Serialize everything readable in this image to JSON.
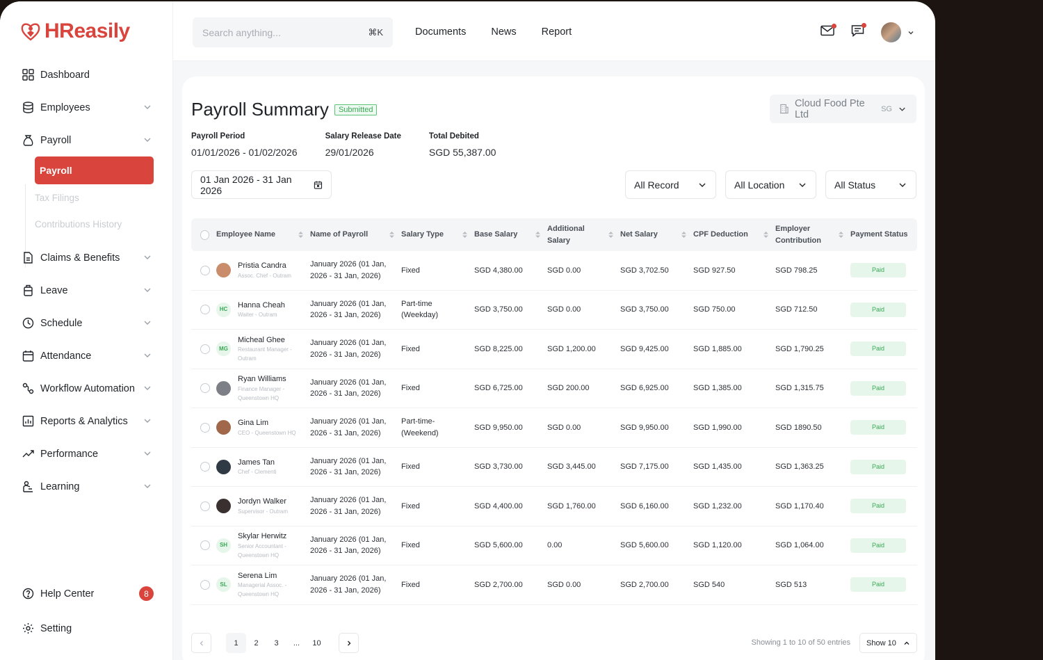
{
  "app": {
    "logo": "HReasily",
    "brand_color": "#d9443c"
  },
  "sidebar": {
    "items": [
      {
        "label": "Dashboard",
        "icon": "grid-icon",
        "chevron": false
      },
      {
        "label": "Employees",
        "icon": "database-icon",
        "chevron": true
      },
      {
        "label": "Payroll",
        "icon": "money-bag-icon",
        "chevron": true
      }
    ],
    "payroll_sub": {
      "active": "Payroll",
      "items": [
        "Tax Filings",
        "Contributions History"
      ]
    },
    "items2": [
      {
        "label": "Claims & Benefits",
        "icon": "document-icon"
      },
      {
        "label": "Leave",
        "icon": "luggage-icon"
      },
      {
        "label": "Schedule",
        "icon": "clock-icon"
      },
      {
        "label": "Attendance",
        "icon": "calendar-icon"
      },
      {
        "label": "Workflow Automation",
        "icon": "workflow-icon"
      },
      {
        "label": "Reports & Analytics",
        "icon": "report-icon"
      },
      {
        "label": "Performance",
        "icon": "trend-icon"
      },
      {
        "label": "Learning",
        "icon": "learning-icon"
      }
    ],
    "help": {
      "label": "Help Center",
      "badge": "8"
    },
    "setting": {
      "label": "Setting"
    }
  },
  "topbar": {
    "search_placeholder": "Search anything...",
    "shortcut": "⌘K",
    "nav": [
      "Documents",
      "News",
      "Report"
    ]
  },
  "page": {
    "title": "Payroll Summary",
    "status": "Submitted",
    "company": "Cloud Food Pte Ltd",
    "company_country": "SG",
    "meta": [
      {
        "label": "Payroll Period",
        "value": "01/01/2026 - 01/02/2026"
      },
      {
        "label": "Salary Release Date",
        "value": "29/01/2026"
      },
      {
        "label": "Total Debited",
        "value": "SGD 55,387.00"
      }
    ],
    "date_range": "01 Jan 2026 - 31 Jan 2026",
    "filters": [
      "All Record",
      "All Location",
      "All Status"
    ]
  },
  "table": {
    "headers": [
      "Employee Name",
      "Name of Payroll",
      "Salary Type",
      "Base Salary",
      "Additional Salary",
      "Net Salary",
      "CPF Deduction",
      "Employer Contribution",
      "Payment Status"
    ],
    "rows": [
      {
        "name": "Pristia Candra",
        "role": "Assoc. Chef - Outram",
        "initials": "",
        "avatar": "#c98d6b",
        "payroll": "January 2026 (01 Jan, 2026 - 31 Jan, 2026)",
        "type": "Fixed",
        "base": "SGD 4,380.00",
        "add": "SGD 0.00",
        "net": "SGD 3,702.50",
        "cpf": "SGD 927.50",
        "emp": "SGD 798.25",
        "status": "Paid"
      },
      {
        "name": "Hanna Cheah",
        "role": "Waiter - Outram",
        "initials": "HC",
        "avatar": "",
        "payroll": "January 2026 (01 Jan, 2026 - 31 Jan, 2026)",
        "type": "Part-time (Weekday)",
        "base": "SGD 3,750.00",
        "add": "SGD 0.00",
        "net": "SGD 3,750.00",
        "cpf": "SGD 750.00",
        "emp": "SGD 712.50",
        "status": "Paid"
      },
      {
        "name": "Micheal Ghee",
        "role": "Restaurant Manager - Outram",
        "initials": "MG",
        "avatar": "",
        "payroll": "January 2026 (01 Jan, 2026 - 31 Jan, 2026)",
        "type": "Fixed",
        "base": "SGD 8,225.00",
        "add": "SGD 1,200.00",
        "net": "SGD 9,425.00",
        "cpf": "SGD 1,885.00",
        "emp": "SGD 1,790.25",
        "status": "Paid"
      },
      {
        "name": "Ryan Williams",
        "role": "Finance Manager - Queenstown HQ",
        "initials": "",
        "avatar": "#7d7f86",
        "payroll": "January 2026 (01 Jan, 2026 - 31 Jan, 2026)",
        "type": "Fixed",
        "base": "SGD 6,725.00",
        "add": "SGD 200.00",
        "net": "SGD 6,925.00",
        "cpf": "SGD 1,385.00",
        "emp": "SGD 1,315.75",
        "status": "Paid"
      },
      {
        "name": "Gina Lim",
        "role": "CEO - Queenstown HQ",
        "initials": "",
        "avatar": "#a0674a",
        "payroll": "January 2026 (01 Jan, 2026 - 31 Jan, 2026)",
        "type": "Part-time- (Weekend)",
        "base": "SGD 9,950.00",
        "add": "SGD 0.00",
        "net": "SGD 9,950.00",
        "cpf": "SGD 1,990.00",
        "emp": "SGD 1890.50",
        "status": "Paid"
      },
      {
        "name": "James Tan",
        "role": "Chef - Clementi",
        "initials": "",
        "avatar": "#2f3a45",
        "payroll": "January 2026 (01 Jan, 2026 - 31 Jan, 2026)",
        "type": "Fixed",
        "base": "SGD 3,730.00",
        "add": "SGD 3,445.00",
        "net": "SGD 7,175.00",
        "cpf": "SGD 1,435.00",
        "emp": "SGD 1,363.25",
        "status": "Paid"
      },
      {
        "name": "Jordyn Walker",
        "role": "Supervisor - Outram",
        "initials": "",
        "avatar": "#3b3030",
        "payroll": "January 2026 (01 Jan, 2026 - 31 Jan, 2026)",
        "type": "Fixed",
        "base": "SGD 4,400.00",
        "add": "SGD 1,760.00",
        "net": "SGD 6,160.00",
        "cpf": "SGD 1,232.00",
        "emp": "SGD 1,170.40",
        "status": "Paid"
      },
      {
        "name": "Skylar Herwitz",
        "role": "Senior Accountant - Queenstown HQ",
        "initials": "SH",
        "avatar": "",
        "payroll": "January 2026 (01 Jan, 2026 - 31 Jan, 2026)",
        "type": "Fixed",
        "base": "SGD 5,600.00",
        "add": "0.00",
        "net": "SGD 5,600.00",
        "cpf": "SGD 1,120.00",
        "emp": "SGD 1,064.00",
        "status": "Paid"
      },
      {
        "name": "Serena Lim",
        "role": "Managerial Assoc. - Queenstown HQ",
        "initials": "SL",
        "avatar": "",
        "payroll": "January 2026 (01 Jan, 2026 - 31 Jan, 2026)",
        "type": "Fixed",
        "base": "SGD 2,700.00",
        "add": "SGD 0.00",
        "net": "SGD 2,700.00",
        "cpf": "SGD 540",
        "emp": "SGD 513",
        "status": "Paid"
      }
    ]
  },
  "pagination": {
    "pages": [
      "1",
      "2",
      "3",
      "...",
      "10"
    ],
    "current": "1",
    "showing": "Showing 1 to 10 of 50 entries",
    "page_size": "Show 10"
  }
}
